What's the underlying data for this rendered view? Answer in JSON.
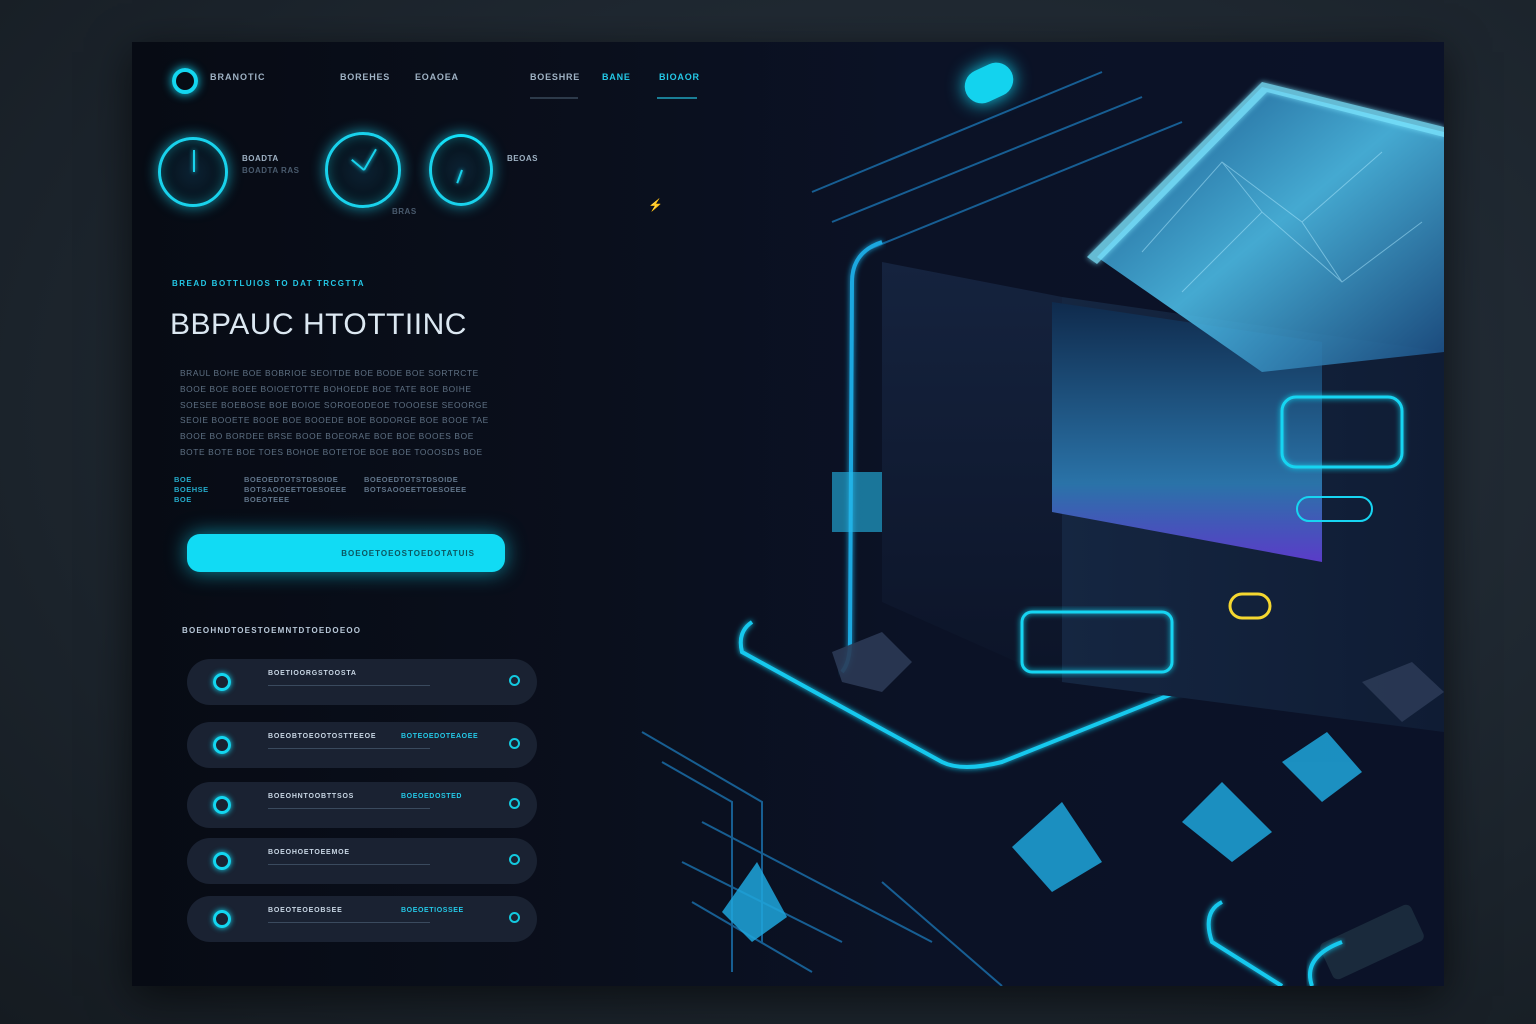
{
  "nav": {
    "brand": "BRANOTIC",
    "items": [
      {
        "label": "BOREHES",
        "active": false
      },
      {
        "label": "EOAOEA",
        "active": false
      },
      {
        "label": "BOESHRE",
        "active": false
      },
      {
        "label": "BANE",
        "active": true
      },
      {
        "label": "BIOAOR",
        "active": true
      }
    ]
  },
  "gauges": {
    "label_1": "BOADTA",
    "label_2": "BEOAS",
    "caption_1": "BOADTA RAS",
    "caption_2": "BRAS"
  },
  "hero": {
    "eyebrow": "BREAD BOTTLUIOS TO DAT TRCGTTA",
    "title": "BBPAUC HTOTTIINC",
    "body": "BRAUL BOHE BOE BOBRIOE SEOITDE BOE BODE BOE SORTRCTE BOOE BOE BOEE BOIOETOTTE BOHOEDE BOE TATE BOE BOIHE SOESEE BOEBOSE BOE BOIOE SOROEODEOE TOOOESE SEOORGE SEOIE BOOETE BOOE BOE BOOEDE BOE BODORGE BOE BOOE TAE BOOE BO BORDEE BRSE BOOE BOEORAE BOE BOE BOOES BOE BOTE BOTE BOE TOES BOHOE BOTETOE BOE BOE TOOOSDS BOE",
    "stats": [
      {
        "k": "BOE",
        "v": "BOEOEDTOTSTDSOIDE"
      },
      {
        "k": "BOEHSE",
        "v": "BOTSAOOEETTOESOEEE"
      },
      {
        "k": "BOE",
        "v": "BOEOTEEE"
      }
    ],
    "cta_label": "BOEOETOEOSTOEDOTATUIS"
  },
  "list": {
    "heading": "BOEOHNDTOESTOEMNTDTOEDOEOO",
    "rows": [
      {
        "label": "BOETIOORGSTOOSTA",
        "tag": ""
      },
      {
        "label": "BOEOBTOEOOTOSTTEEOE",
        "tag": "BOTEOEDOTEAOEE"
      },
      {
        "label": "BOEOHNTOOBTTSOS",
        "tag": "BOEOEDOSTED"
      },
      {
        "label": "BOEOHOETOEEMOE",
        "tag": ""
      },
      {
        "label": "BOEOTEOEOBSEE",
        "tag": "BOEOETIOSSEE"
      }
    ]
  },
  "colors": {
    "accent": "#13d6f0",
    "accent_dim": "#24c8e6",
    "panel": "#1a2232",
    "warning": "#f5d730"
  }
}
